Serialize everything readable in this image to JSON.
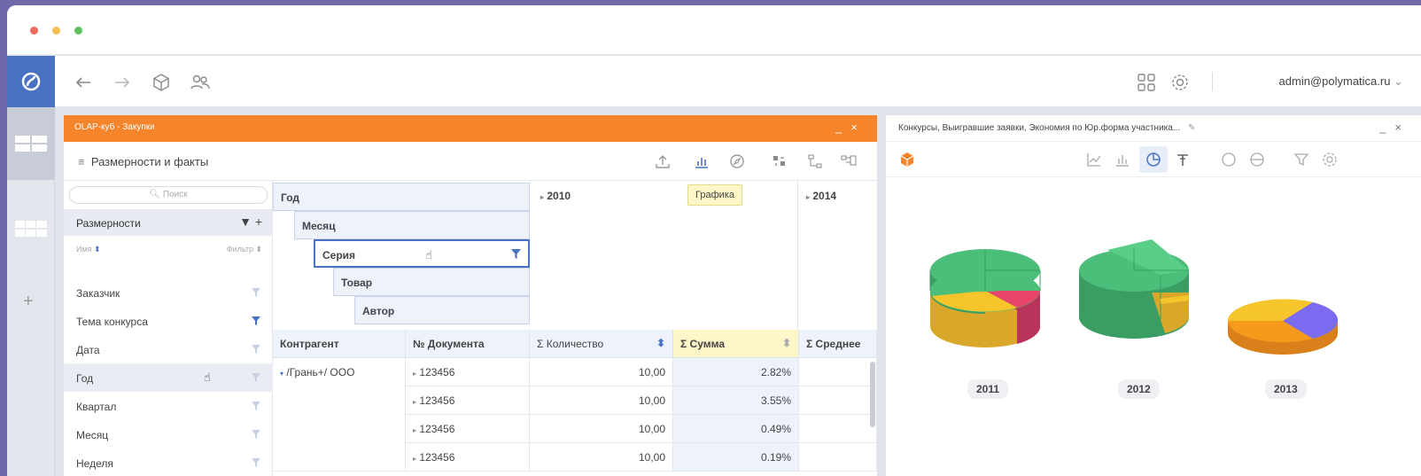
{
  "topbar": {
    "user": "admin@polymatica.ru"
  },
  "olap": {
    "title": "OLAP-куб - Закупки",
    "menu_label": "Размерности и факты",
    "tooltip": "Графика",
    "search_placeholder": "Поиск",
    "dims_title": "Размерности",
    "sub_name": "Имя",
    "sub_filter": "Фильтр",
    "dimensions": [
      "Заказчик",
      "Тема конкурса",
      "Дата",
      "Год",
      "Квартал",
      "Месяц",
      "Неделя"
    ],
    "row_headers": [
      "Год",
      "Месяц",
      "Серия",
      "Товар",
      "Автор"
    ],
    "years": [
      "2010",
      "2014"
    ],
    "columns": [
      "Контрагент",
      "№ Документа",
      "Σ Количество",
      "Σ Сумма",
      "Σ Среднее"
    ],
    "group_label": "/Грань+/ ООО",
    "rows": [
      {
        "doc": "123456",
        "qty": "10,00",
        "sum": "2.82%"
      },
      {
        "doc": "123456",
        "qty": "10,00",
        "sum": "3.55%"
      },
      {
        "doc": "123456",
        "qty": "10,00",
        "sum": "0.49%"
      },
      {
        "doc": "123456",
        "qty": "10,00",
        "sum": "0.19%"
      }
    ]
  },
  "chart_panel": {
    "title": "Конкурсы, Выигравшие заявки, Экономия по Юр.форма участника...",
    "years": [
      "2011",
      "2012",
      "2013"
    ]
  },
  "colors": {
    "orange": "#f5842b",
    "blue": "#4a72c4",
    "green": "#4bbf7a",
    "yellow": "#f5c52b",
    "red": "#e8456a",
    "purple": "#7b6bf0",
    "dark_orange": "#f59a1b"
  }
}
